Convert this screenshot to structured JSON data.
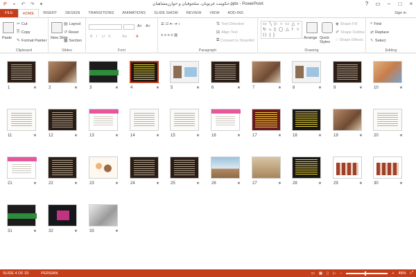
{
  "window": {
    "title": "حکومت غزنویان، سلجوقیان و خوارزمشاهیان.pptx - PowerPoint",
    "signin": "Sign in"
  },
  "tabs": [
    {
      "label": "FILE"
    },
    {
      "label": "HOME"
    },
    {
      "label": "INSERT"
    },
    {
      "label": "DESIGN"
    },
    {
      "label": "TRANSITIONS"
    },
    {
      "label": "ANIMATIONS"
    },
    {
      "label": "SLIDE SHOW"
    },
    {
      "label": "REVIEW"
    },
    {
      "label": "VIEW"
    },
    {
      "label": "ADD-INS"
    }
  ],
  "ribbon": {
    "clipboard": {
      "paste": "Paste",
      "cut": "Cut",
      "copy": "Copy",
      "format_painter": "Format Painter",
      "label": "Clipboard"
    },
    "slides": {
      "new_slide": "New Slide",
      "layout": "Layout",
      "reset": "Reset",
      "section": "Section",
      "label": "Slides"
    },
    "font": {
      "label": "Font",
      "bold": "B",
      "italic": "I",
      "underline": "U",
      "strike": "S",
      "aa": "Aa"
    },
    "paragraph": {
      "text_direction": "Text Direction",
      "align_text": "Align Text",
      "convert_smartart": "Convert to SmartArt",
      "label": "Paragraph"
    },
    "drawing": {
      "shapes_glyphs": "▭ ╲ ▷ ○ ▭ △ ⌐ ↻ ⤷ ▯ ◯ △ ⌇ ☆ ⟨⟩ { }",
      "arrange": "Arrange",
      "quick_styles": "Quick Styles",
      "shape_fill": "Shape Fill",
      "shape_outline": "Shape Outline",
      "shape_effects": "Shape Effects",
      "label": "Drawing"
    },
    "editing": {
      "find": "Find",
      "replace": "Replace",
      "select": "Select",
      "label": "Editing"
    }
  },
  "slides": [
    {
      "n": "1",
      "style": "dark"
    },
    {
      "n": "2",
      "style": "photo"
    },
    {
      "n": "3",
      "style": "green"
    },
    {
      "n": "4",
      "style": "yellow"
    },
    {
      "n": "5",
      "style": "diagram"
    },
    {
      "n": "6",
      "style": "dark"
    },
    {
      "n": "7",
      "style": "photo"
    },
    {
      "n": "8",
      "style": "diagram"
    },
    {
      "n": "9",
      "style": "dark"
    },
    {
      "n": "10",
      "style": "map"
    },
    {
      "n": "11",
      "style": "white"
    },
    {
      "n": "12",
      "style": "dark"
    },
    {
      "n": "13",
      "style": "pink"
    },
    {
      "n": "14",
      "style": "white"
    },
    {
      "n": "15",
      "style": "white"
    },
    {
      "n": "16",
      "style": "pink"
    },
    {
      "n": "17",
      "style": "red"
    },
    {
      "n": "18",
      "style": "yellow"
    },
    {
      "n": "19",
      "style": "photo"
    },
    {
      "n": "20",
      "style": "white"
    },
    {
      "n": "21",
      "style": "pink"
    },
    {
      "n": "22",
      "style": "dark"
    },
    {
      "n": "23",
      "style": "cartoon"
    },
    {
      "n": "24",
      "style": "dark"
    },
    {
      "n": "25",
      "style": "dark"
    },
    {
      "n": "26",
      "style": "tower"
    },
    {
      "n": "27",
      "style": "stone"
    },
    {
      "n": "28",
      "style": "yellow"
    },
    {
      "n": "29",
      "style": "bars"
    },
    {
      "n": "30",
      "style": "bars"
    },
    {
      "n": "31",
      "style": "green"
    },
    {
      "n": "32",
      "style": "magenta"
    },
    {
      "n": "33",
      "style": "laptop"
    }
  ],
  "selected_slide": 4,
  "star": "★",
  "status": {
    "slide_of": "SLIDE 4 OF 33",
    "language": "PERSIAN",
    "zoom": "48%",
    "zoom_level": 0.48
  },
  "colors": {
    "accent": "#c43e1c"
  }
}
